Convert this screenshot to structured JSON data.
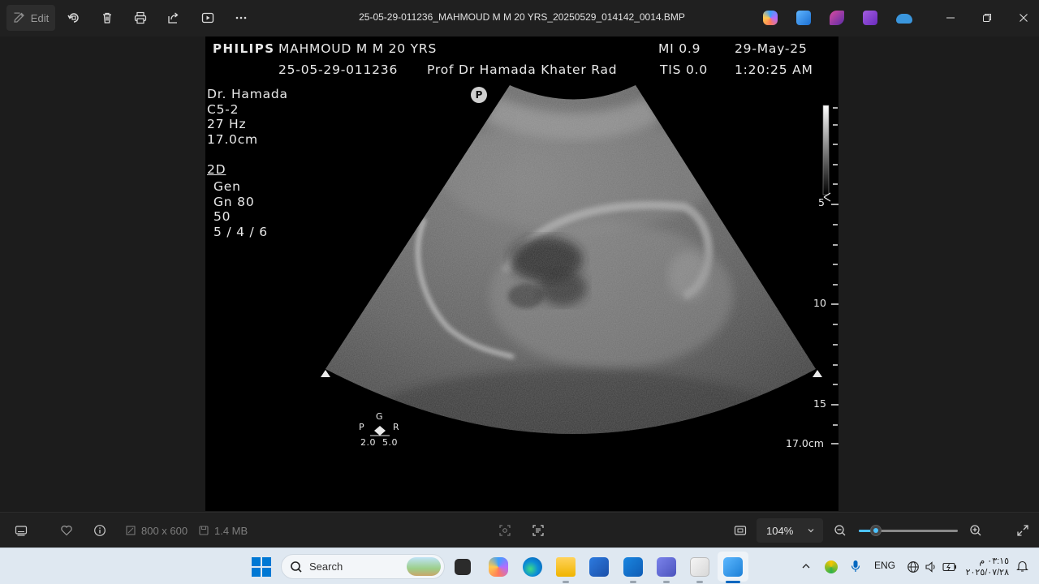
{
  "toolbar": {
    "edit_label": "Edit",
    "filename": "25-05-29-011236_MAHMOUD M M 20 YRS_20250529_014142_0014.BMP"
  },
  "ultrasound": {
    "brand": "PHILIPS",
    "patient": "MAHMOUD M M 20 YRS",
    "study_id": "25-05-29-011236",
    "institution": "Prof Dr Hamada Khater Rad",
    "mi": "MI 0.9",
    "tis": "TIS 0.0",
    "date": "29-May-25",
    "time": "1:20:25 AM",
    "operator": "Dr. Hamada",
    "probe": "C5-2",
    "frame_rate": "27 Hz",
    "depth": "17.0cm",
    "mode": "2D",
    "preset": "Gen",
    "gain": "Gn 80",
    "dynamic_range": "50",
    "settings": "5 / 4 / 6",
    "marker": "P",
    "orient_top": "G",
    "orient_left": "P",
    "orient_right": "R",
    "orient_values": "2.0  5.0",
    "depth_marks": [
      "5",
      "10",
      "15"
    ],
    "depth_end": "17.0cm"
  },
  "infobar": {
    "dimensions": "800 x 600",
    "file_size": "1.4 MB",
    "zoom": "104%",
    "zoom_level": 0.17
  },
  "taskbar": {
    "search_placeholder": "Search",
    "language": "ENG",
    "clock_time": "٠٣:١٥ م",
    "clock_date": "٢٠٢٥/٠٧/٢٨"
  },
  "colors": {
    "accent": "#4cc2ff",
    "background": "#1c1c1c",
    "taskbar": "#dfe8f1"
  }
}
